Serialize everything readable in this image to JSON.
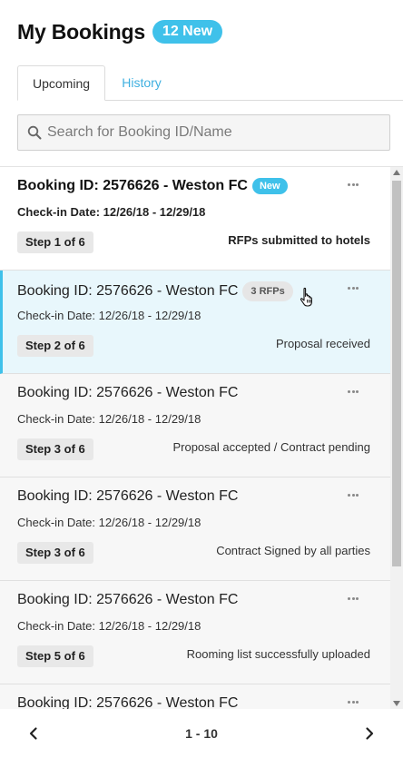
{
  "header": {
    "title": "My Bookings",
    "new_badge": "12 New"
  },
  "tabs": [
    {
      "label": "Upcoming",
      "active": true
    },
    {
      "label": "History",
      "active": false
    }
  ],
  "search": {
    "placeholder": "Search for Booking ID/Name",
    "value": "",
    "icon": "search-icon"
  },
  "bookings": [
    {
      "title": "Booking ID: 2576626 - Weston FC",
      "badge": "New",
      "checkin": "Check-in Date: 12/26/18 - 12/29/18",
      "step": "Step 1 of 6",
      "status": "RFPs submitted to hotels",
      "unread": true
    },
    {
      "title": "Booking ID: 2576626 - Weston FC",
      "badge": "3 RFPs",
      "checkin": "Check-in Date: 12/26/18 - 12/29/18",
      "step": "Step 2 of 6",
      "status": "Proposal received",
      "selected": true
    },
    {
      "title": "Booking ID: 2576626 - Weston FC",
      "badge": "",
      "checkin": "Check-in Date: 12/26/18 - 12/29/18",
      "step": "Step 3 of 6",
      "status": "Proposal accepted / Contract pending"
    },
    {
      "title": "Booking ID: 2576626 - Weston FC",
      "badge": "",
      "checkin": "Check-in Date: 12/26/18 - 12/29/18",
      "step": "Step 3 of 6",
      "status": "Contract Signed by all parties"
    },
    {
      "title": "Booking ID: 2576626 - Weston FC",
      "badge": "",
      "checkin": "Check-in Date: 12/26/18 - 12/29/18",
      "step": "Step 5 of 6",
      "status": "Rooming list successfully uploaded"
    },
    {
      "title": "Booking ID: 2576626 - Weston FC",
      "badge": "",
      "checkin": "",
      "step": "",
      "status": ""
    }
  ],
  "more_icon": "more-horizontal-icon",
  "pagination": {
    "label": "1 - 10",
    "prev_icon": "chevron-left-icon",
    "next_icon": "chevron-right-icon"
  },
  "colors": {
    "accent": "#3fc1ea",
    "selected_bg": "#e8f7fc",
    "card_bg": "#f7f7f7"
  }
}
